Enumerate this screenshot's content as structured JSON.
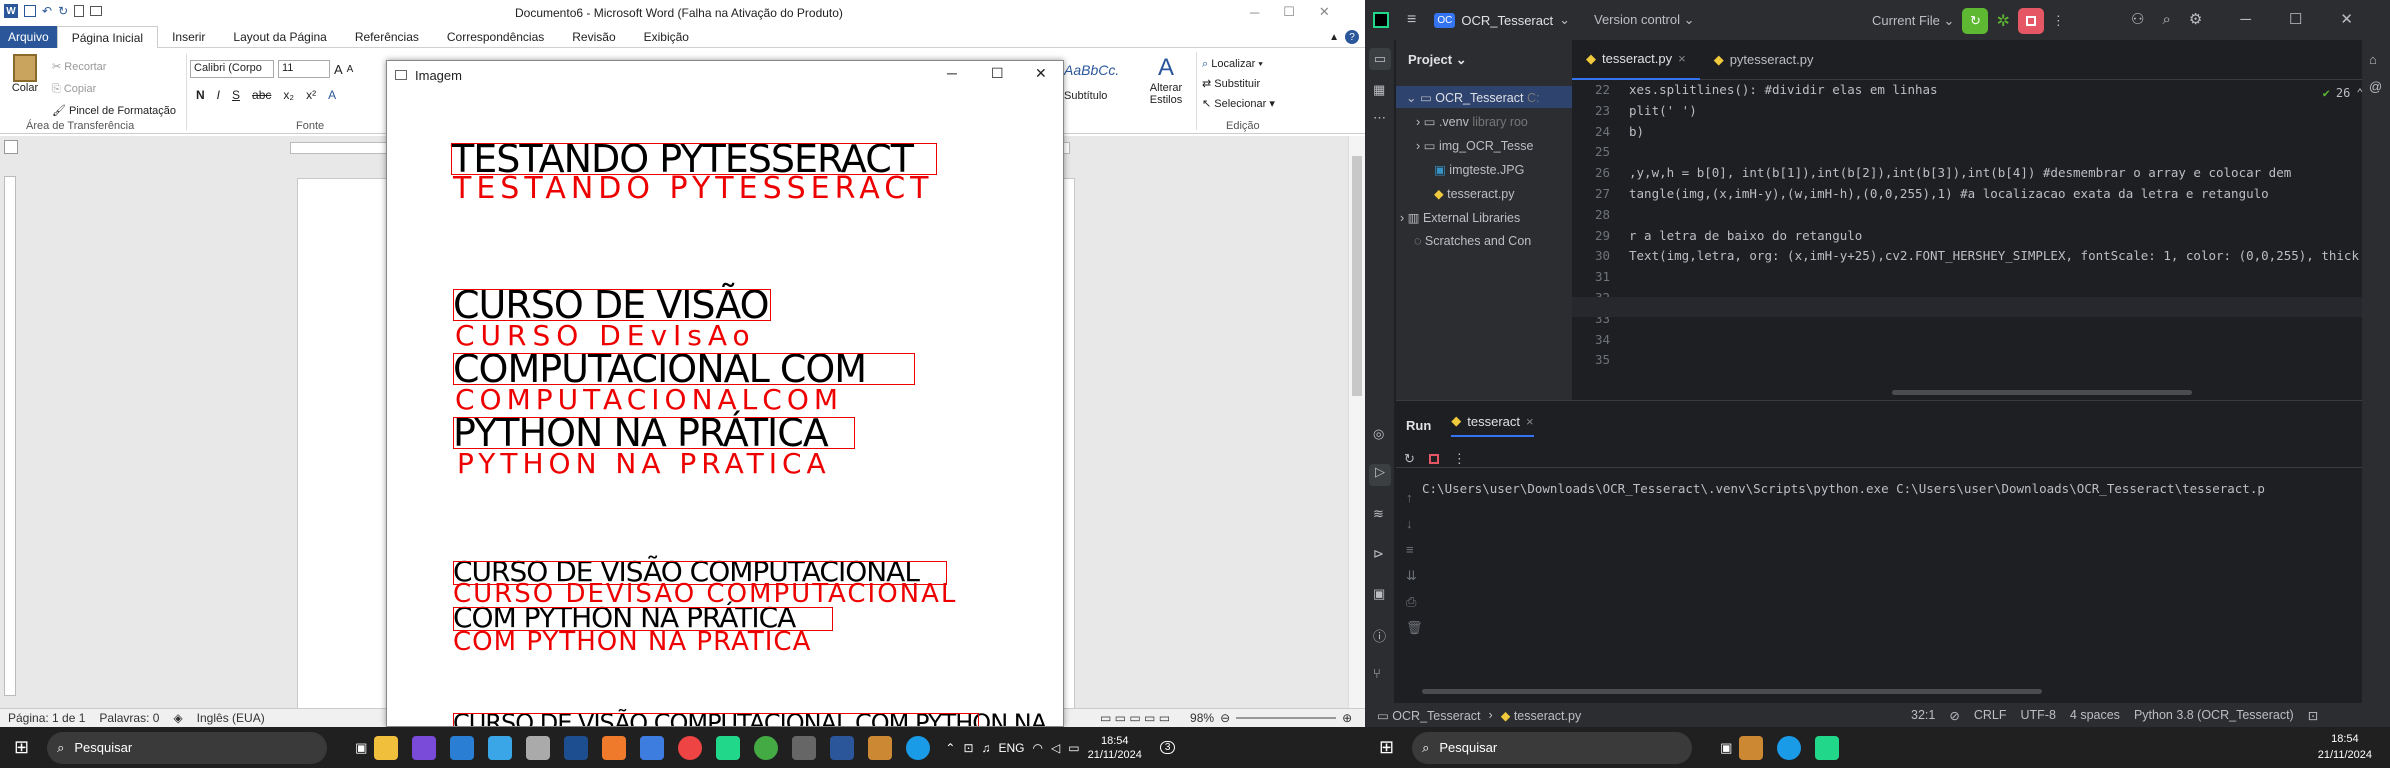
{
  "word": {
    "title": "Documento6 - Microsoft Word (Falha na Ativação do Produto)",
    "tabs": [
      "Arquivo",
      "Página Inicial",
      "Inserir",
      "Layout da Página",
      "Referências",
      "Correspondências",
      "Revisão",
      "Exibição"
    ],
    "clipboard": {
      "paste": "Colar",
      "cut": "Recortar",
      "copy": "Copiar",
      "painter": "Pincel de Formatação",
      "group": "Área de Transferência"
    },
    "font": {
      "name": "Calibri (Corpo",
      "size": "11",
      "group": "Fonte"
    },
    "styles": {
      "sample": "AaBbCc.",
      "subtitle": "Subtítulo",
      "change": "Alterar Estilos"
    },
    "editing": {
      "find": "Localizar",
      "replace": "Substituir",
      "select": "Selecionar",
      "group": "Edição"
    },
    "status": {
      "page": "Página: 1 de 1",
      "words": "Palavras: 0",
      "lang": "Inglês (EUA)",
      "zoom": "98%"
    }
  },
  "image_window": {
    "title": "Imagem",
    "lines": [
      {
        "black": "TESTANDO PYTESSERACT",
        "red": "TESTANDO PYTESSERACT"
      },
      {
        "black": "CURSO DE VISÃO",
        "red": "CURSO DEvIsAo"
      },
      {
        "black": "COMPUTACIONAL COM",
        "red": "COMPUTACIONALCOM"
      },
      {
        "black": "PYTHON NA PRÁTICA",
        "red": "PYTHON NA PRATICA"
      },
      {
        "black": "CURSO DE VISÃO COMPUTACIONAL",
        "red": "CURSO DEVISAO COMPUTACIONAL"
      },
      {
        "black": "COM PYTHON NA PRÁTICA",
        "red": "COM PYTHON NA PRATICA"
      },
      {
        "black": "CURSO DE VISÃO COMPUTACIONAL COM PYTHON NA",
        "red": ""
      }
    ]
  },
  "ide": {
    "project": "OCR_Tesseract",
    "vcs": "Version control",
    "run_config": "Current File",
    "tabs": [
      "tesseract.py",
      "pytesseract.py"
    ],
    "tree": {
      "header": "Project",
      "root": "OCR_Tesseract",
      "root_hint": "C:",
      "items": [
        ".venv",
        "img_OCR_Tesse",
        "imgteste.JPG",
        "tesseract.py",
        "External Libraries",
        "Scratches and Con"
      ],
      "venv_hint": "library roo"
    },
    "warnings": "26",
    "line_numbers": [
      "22",
      "23",
      "24",
      "25",
      "26",
      "27",
      "28",
      "29",
      "30",
      "31",
      "32",
      "33",
      "34",
      "35"
    ],
    "code": [
      "xes.splitlines(): #dividir elas em linhas",
      "plit(' ')",
      "b)",
      "",
      ",y,w,h = b[0], int(b[1]),int(b[2]),int(b[3]),int(b[4]) #desmembrar o array e colocar dem",
      "tangle(img,(x,imH-y),(w,imH-h),(0,0,255),1) #a localizacao exata da letra e retangulo",
      "",
      "r a letra de baixo do retangulo",
      "Text(img,letra, org: (x,imH-y+25),cv2.FONT_HERSHEY_SIMPLEX, fontScale: 1, color: (0,0,255), thick",
      "",
      "",
      "",
      "",
      ""
    ],
    "run": {
      "label": "Run",
      "tab": "tesseract",
      "command": "C:\\Users\\user\\Downloads\\OCR_Tesseract\\.venv\\Scripts\\python.exe C:\\Users\\user\\Downloads\\OCR_Tesseract\\tesseract.p"
    },
    "status": {
      "crumb1": "OCR_Tesseract",
      "crumb2": "tesseract.py",
      "pos": "32:1",
      "eol": "CRLF",
      "enc": "UTF-8",
      "indent": "4 spaces",
      "interp": "Python 3.8 (OCR_Tesseract)"
    }
  },
  "taskbar": {
    "search": "Pesquisar",
    "lang": "ENG",
    "time": "18:54",
    "date": "21/11/2024",
    "badge": "3"
  },
  "colors": {
    "accent": "#2b579a",
    "ide_bg": "#1e1f22",
    "run_green": "#5fb832",
    "stop_red": "#e55765",
    "ocr_red": "#ee0000"
  }
}
